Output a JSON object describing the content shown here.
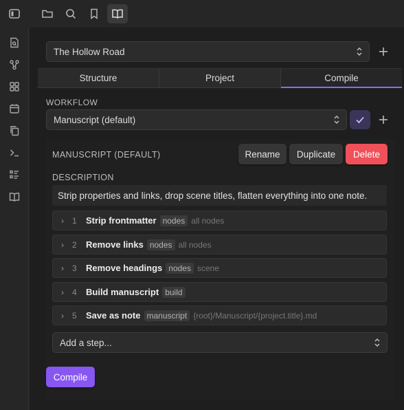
{
  "top_icons": [
    "sidebar-toggle-icon",
    "folder-icon",
    "search-icon",
    "bookmark-icon",
    "book-open-icon"
  ],
  "ribbon_icons": [
    "file-search-icon",
    "graph-icon",
    "grid-icon",
    "calendar-icon",
    "copy-icon",
    "terminal-icon",
    "checklist-icon",
    "book-icon"
  ],
  "project": {
    "selected": "The Hollow Road"
  },
  "tabs": [
    {
      "label": "Structure"
    },
    {
      "label": "Project"
    },
    {
      "label": "Compile"
    }
  ],
  "workflow": {
    "heading": "WORKFLOW",
    "selected": "Manuscript (default)"
  },
  "panel": {
    "title": "MANUSCRIPT (DEFAULT)",
    "rename_label": "Rename",
    "duplicate_label": "Duplicate",
    "delete_label": "Delete",
    "description_heading": "DESCRIPTION",
    "description": "Strip properties and links, drop scene titles, flatten everything into one note."
  },
  "steps": [
    {
      "num": "1",
      "name": "Strip frontmatter",
      "tag": "nodes",
      "scope": "all nodes"
    },
    {
      "num": "2",
      "name": "Remove links",
      "tag": "nodes",
      "scope": "all nodes"
    },
    {
      "num": "3",
      "name": "Remove headings",
      "tag": "nodes",
      "scope": "scene"
    },
    {
      "num": "4",
      "name": "Build manuscript",
      "tag": "build",
      "scope": ""
    },
    {
      "num": "5",
      "name": "Save as note",
      "tag": "manuscript",
      "scope": "{root}/Manuscript/{project.title}.md"
    }
  ],
  "add_step": {
    "placeholder": "Add a step..."
  },
  "compile_button": "Compile",
  "colors": {
    "accent": "#8856f1",
    "danger": "#f0505a",
    "tab_underline": "#8b6cf2"
  }
}
